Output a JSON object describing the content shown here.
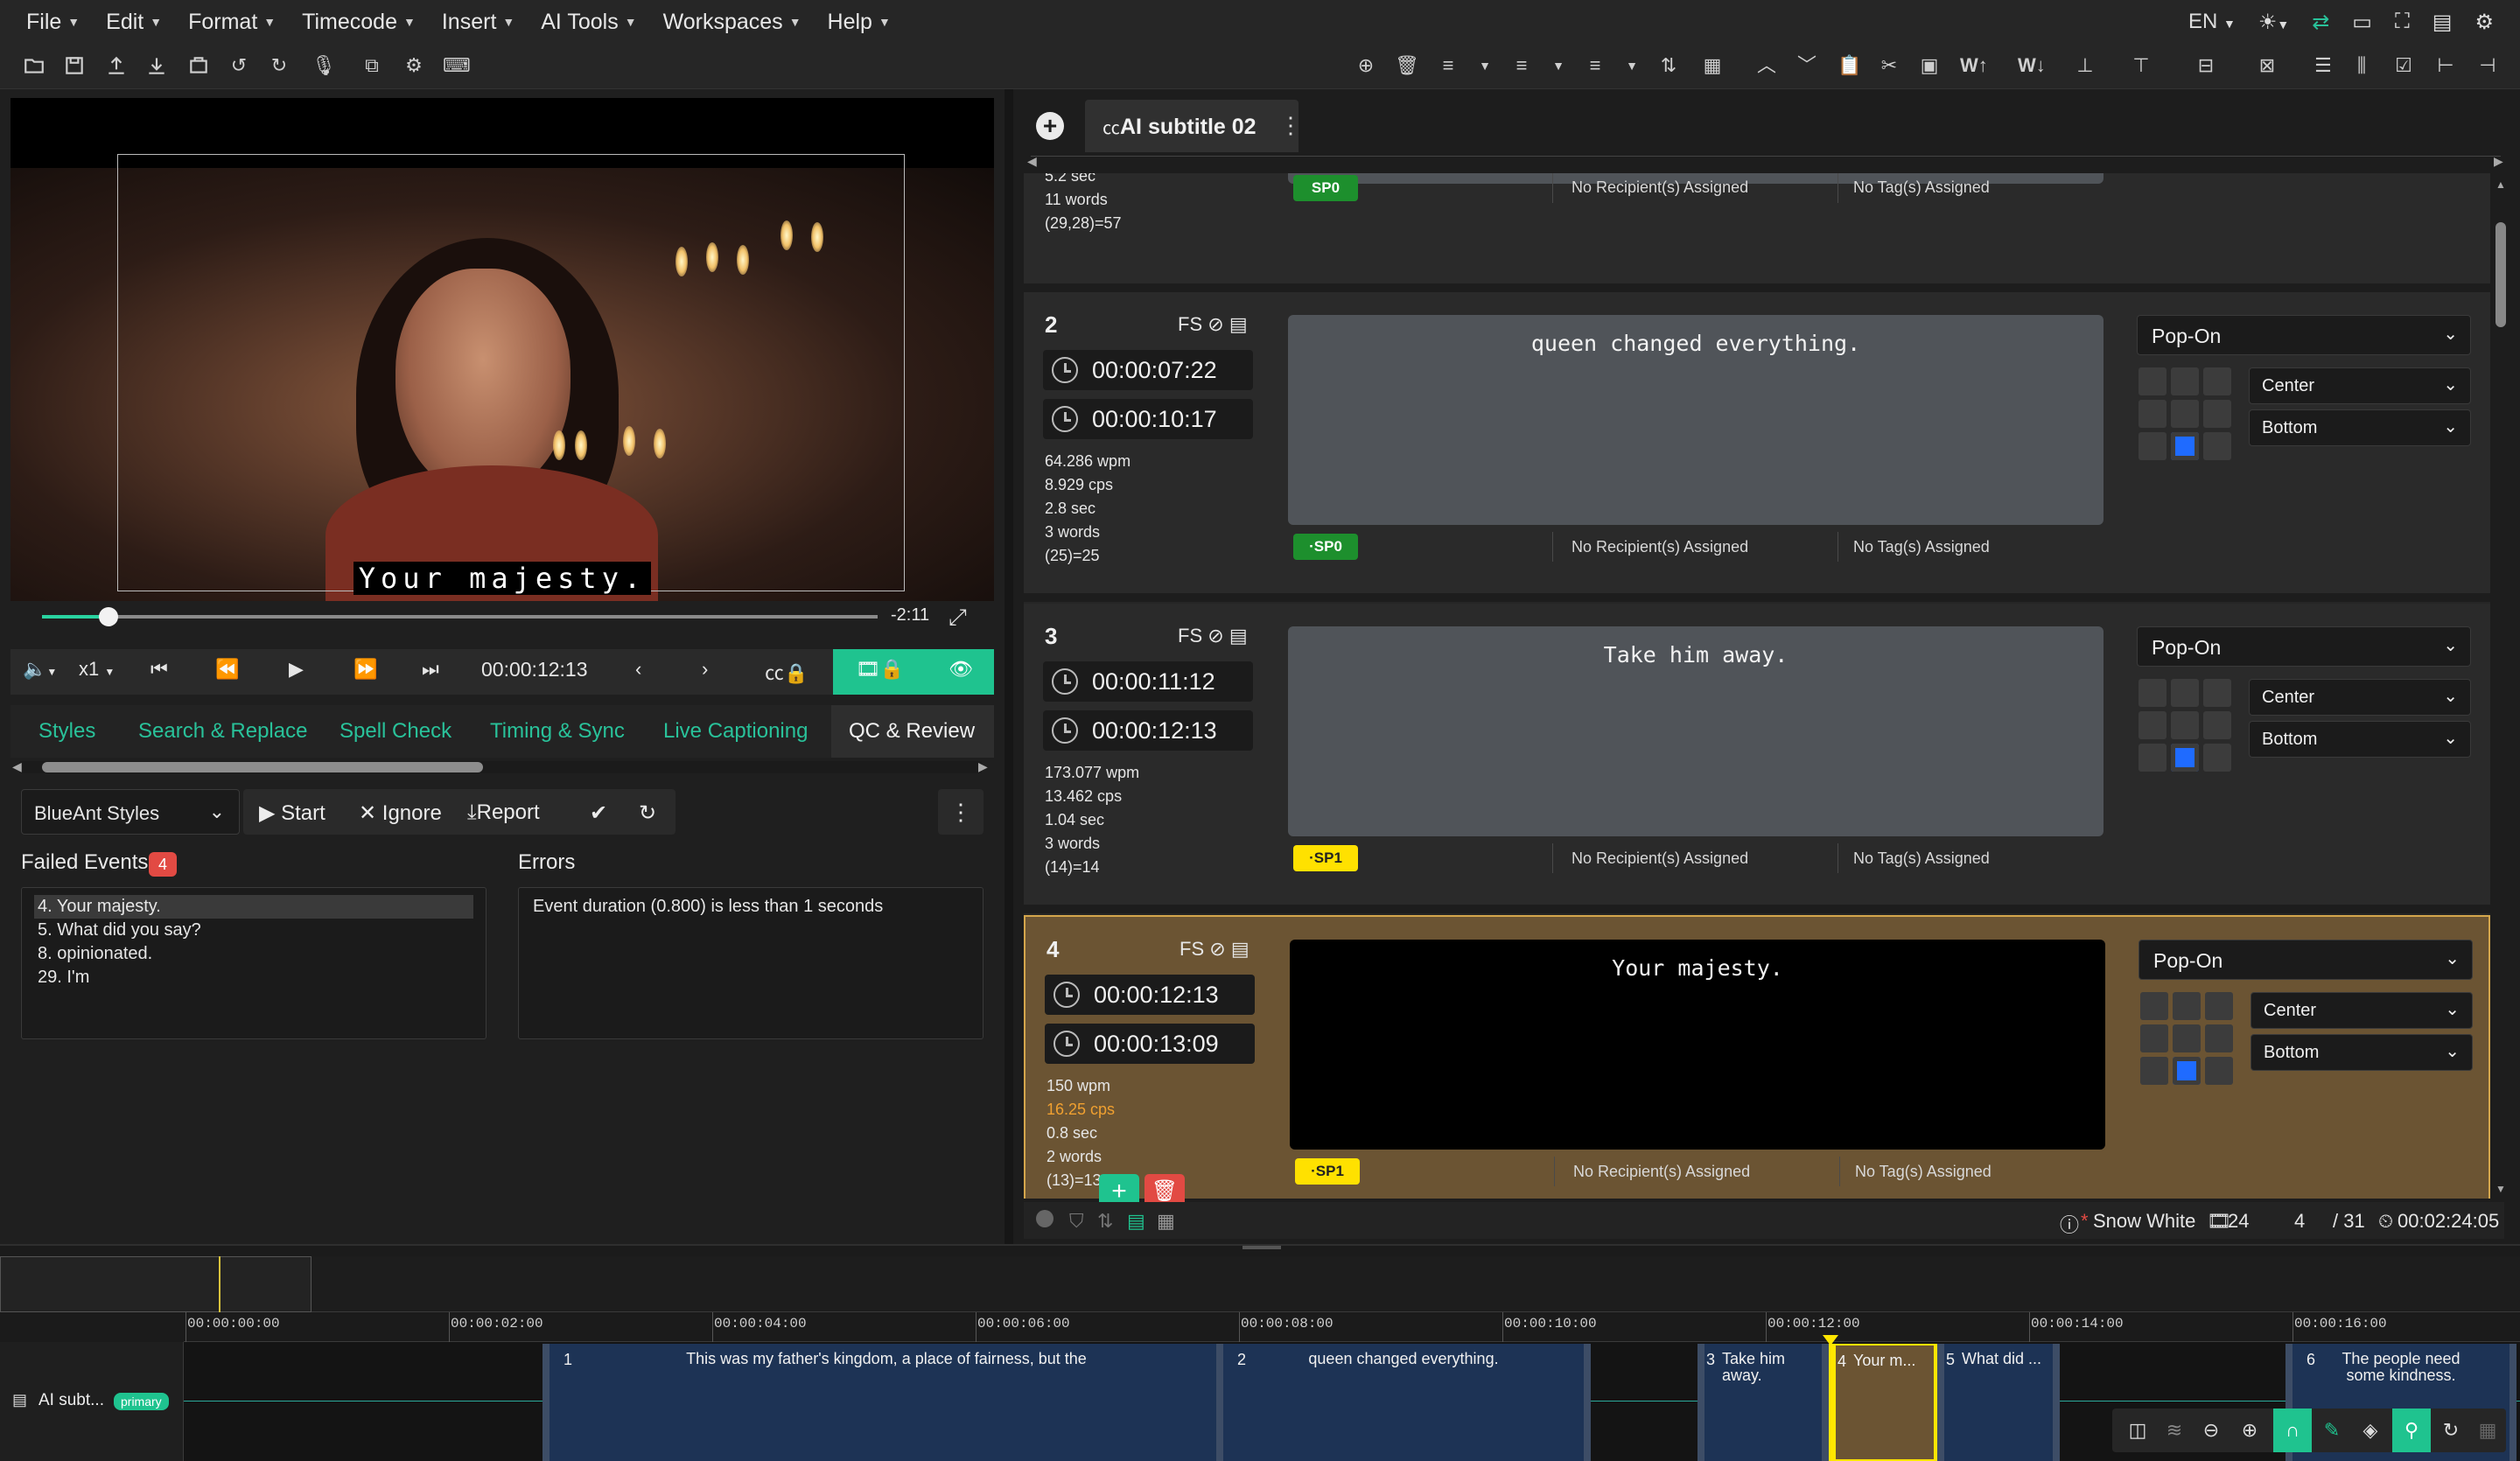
{
  "menu": {
    "items": [
      "File",
      "Edit",
      "Format",
      "Timecode",
      "Insert",
      "AI Tools",
      "Workspaces",
      "Help"
    ],
    "language": "EN"
  },
  "video": {
    "subtitle": "Your majesty.",
    "remaining": "-2:11",
    "progress_fraction": 0.08
  },
  "playback": {
    "speed": "x1",
    "timecode": "00:00:12:13"
  },
  "tabs": [
    "Styles",
    "Search & Replace",
    "Spell Check",
    "Timing & Sync",
    "Live Captioning",
    "QC & Review"
  ],
  "active_tab": "QC & Review",
  "qc": {
    "style_set": "BlueAnt Styles",
    "start": "Start",
    "ignore": "Ignore",
    "report": "Report",
    "failed_label": "Failed Events",
    "failed_count": "4",
    "failed_events": [
      "4. Your majesty.",
      "5. What did you say?",
      "8. opinionated.",
      "29. I'm"
    ],
    "errors_label": "Errors",
    "error_text": "Event duration (0.800) is less than 1 seconds"
  },
  "document": {
    "tab_title": "AI subtitle 02"
  },
  "partial_event": {
    "stats": [
      "5.2 sec",
      "11 words",
      "(29,28)=57"
    ],
    "speaker": "SP0",
    "recipients": "No Recipient(s) Assigned",
    "tags": "No Tag(s) Assigned"
  },
  "events": [
    {
      "num": "2",
      "fs": "FS",
      "start": "00:00:07:22",
      "end": "00:00:10:17",
      "wpm": "64.286 wpm",
      "cps": "8.929 cps",
      "dur": "2.8 sec",
      "words": "3 words",
      "chars": "(25)=25",
      "text": "queen changed everything.",
      "speaker": "SP0",
      "speaker_color": "green",
      "recipients": "No Recipient(s) Assigned",
      "tags": "No Tag(s) Assigned",
      "mode": "Pop-On",
      "align": "Center",
      "vpos": "Bottom"
    },
    {
      "num": "3",
      "fs": "FS",
      "start": "00:00:11:12",
      "end": "00:00:12:13",
      "wpm": "173.077 wpm",
      "cps": "13.462 cps",
      "dur": "1.04 sec",
      "words": "3 words",
      "chars": "(14)=14",
      "text": "Take him away.",
      "speaker": "SP1",
      "speaker_color": "yellow",
      "recipients": "No Recipient(s) Assigned",
      "tags": "No Tag(s) Assigned",
      "mode": "Pop-On",
      "align": "Center",
      "vpos": "Bottom"
    },
    {
      "num": "4",
      "fs": "FS",
      "start": "00:00:12:13",
      "end": "00:00:13:09",
      "wpm": "150 wpm",
      "cps": "16.25 cps",
      "dur": "0.8 sec",
      "words": "2 words",
      "chars": "(13)=13",
      "text": "Your majesty.",
      "speaker": "SP1",
      "speaker_color": "yellow",
      "recipients": "No Recipient(s) Assigned",
      "tags": "No Tag(s) Assigned",
      "mode": "Pop-On",
      "align": "Center",
      "vpos": "Bottom"
    }
  ],
  "status": {
    "project": "Snow White",
    "fps": "24",
    "current": "4",
    "total": "/ 31",
    "duration": "00:02:24:05"
  },
  "timeline": {
    "ticks": [
      "00:00:00:00",
      "00:00:02:00",
      "00:00:04:00",
      "00:00:06:00",
      "00:00:08:00",
      "00:00:10:00",
      "00:00:12:00",
      "00:00:14:00",
      "00:00:16:00"
    ],
    "track_name": "AI subt...",
    "track_badge": "primary",
    "clips": [
      {
        "num": "1",
        "text": "This was my father's kingdom, a place of fairness, but the"
      },
      {
        "num": "2",
        "text": "queen changed everything."
      },
      {
        "num": "3",
        "text": "Take him away."
      },
      {
        "num": "4",
        "text": "Your m..."
      },
      {
        "num": "5",
        "text": "What did ..."
      },
      {
        "num": "6",
        "text": "The people need some kindness."
      }
    ]
  }
}
